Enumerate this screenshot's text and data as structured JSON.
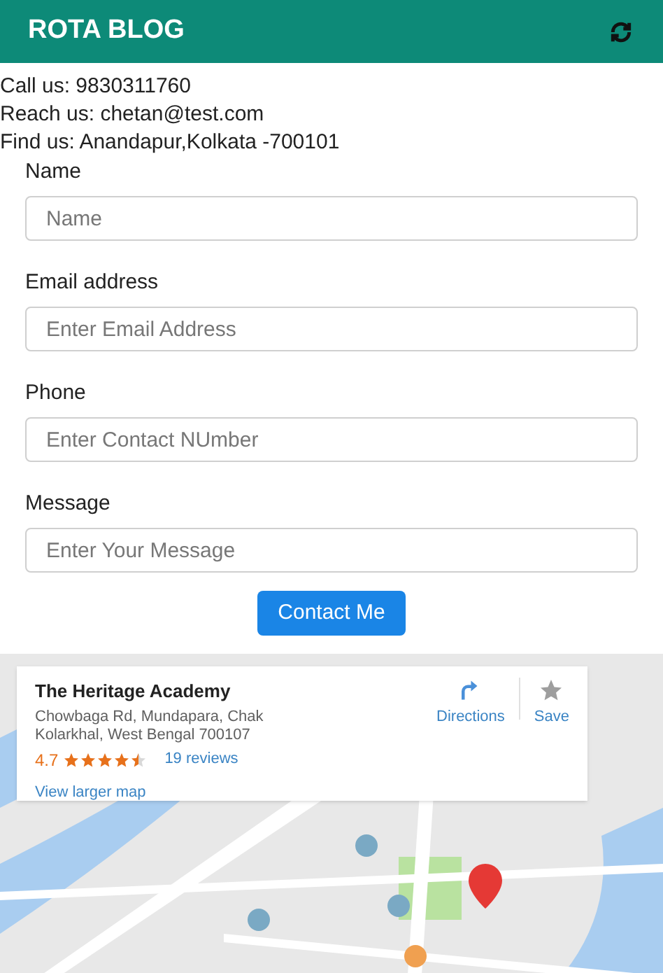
{
  "app_bar": {
    "title": "ROTA BLOG"
  },
  "contact_lines": [
    "Call us: 9830311760",
    "Reach us: chetan@test.com",
    "Find us: Anandapur,Kolkata -700101"
  ],
  "form": {
    "fields": [
      {
        "label": "Name",
        "placeholder": "Name"
      },
      {
        "label": "Email address",
        "placeholder": "Enter Email Address"
      },
      {
        "label": "Phone",
        "placeholder": "Enter Contact NUmber"
      },
      {
        "label": "Message",
        "placeholder": "Enter Your Message"
      }
    ],
    "submit": "Contact Me"
  },
  "map": {
    "kind": "picture",
    "card": {
      "title": "The Heritage Academy",
      "address": "Chowbaga Rd, Mundapara, Chak Kolarkhal, West Bengal 700107",
      "rating": "4.7",
      "stars": 4.5,
      "reviews": "19 reviews",
      "directions": "Directions",
      "save": "Save",
      "larger_map": "View larger map"
    }
  }
}
